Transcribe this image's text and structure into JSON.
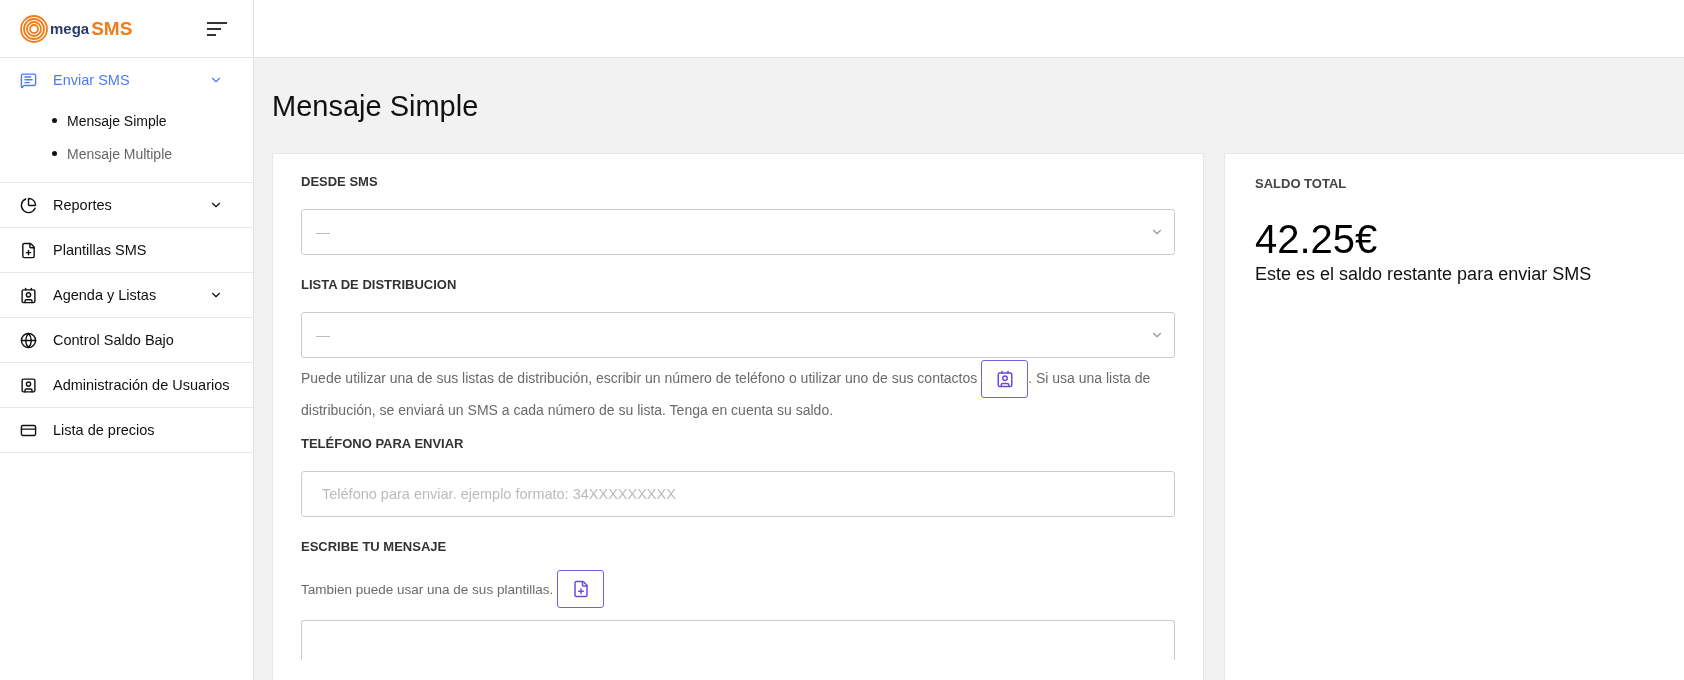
{
  "logo": {
    "text_1": "mega",
    "text_2": "SMS"
  },
  "sidebar": {
    "items": [
      {
        "label": "Enviar SMS",
        "selected": true,
        "expanded": true,
        "children": [
          {
            "label": "Mensaje Simple",
            "selected": true
          },
          {
            "label": "Mensaje Multiple",
            "selected": false
          }
        ]
      },
      {
        "label": "Reportes",
        "selected": false,
        "expanded": false
      },
      {
        "label": "Plantillas SMS",
        "selected": false
      },
      {
        "label": "Agenda y Listas",
        "selected": false,
        "expanded": false
      },
      {
        "label": "Control Saldo Bajo",
        "selected": false
      },
      {
        "label": "Administración de Usuarios",
        "selected": false
      },
      {
        "label": "Lista de precios",
        "selected": false
      }
    ]
  },
  "page_title": "Mensaje Simple",
  "form": {
    "desde_label": "DESDE SMS",
    "desde_value": "—",
    "lista_label": "LISTA DE DISTRIBUCION",
    "lista_value": "—",
    "lista_help_1": "Puede utilizar una de sus listas de distribución, escribir un número de teléfono o utilizar uno de sus contactos ",
    "lista_help_2": ". Si usa una lista de",
    "lista_help_3": "distribución, se enviará un SMS a cada número de su lista. Tenga en cuenta su saldo.",
    "telefono_label": "TELÉFONO PARA ENVIAR",
    "telefono_placeholder": "Teléfono para enviar. ejemplo formato: 34XXXXXXXXX",
    "mensaje_label": "ESCRIBE TU MENSAJE",
    "mensaje_help": "Tambien puede usar una de sus plantillas."
  },
  "balance": {
    "title": "SALDO TOTAL",
    "amount": "42.25€",
    "caption": "Este es el saldo restante para enviar SMS"
  }
}
